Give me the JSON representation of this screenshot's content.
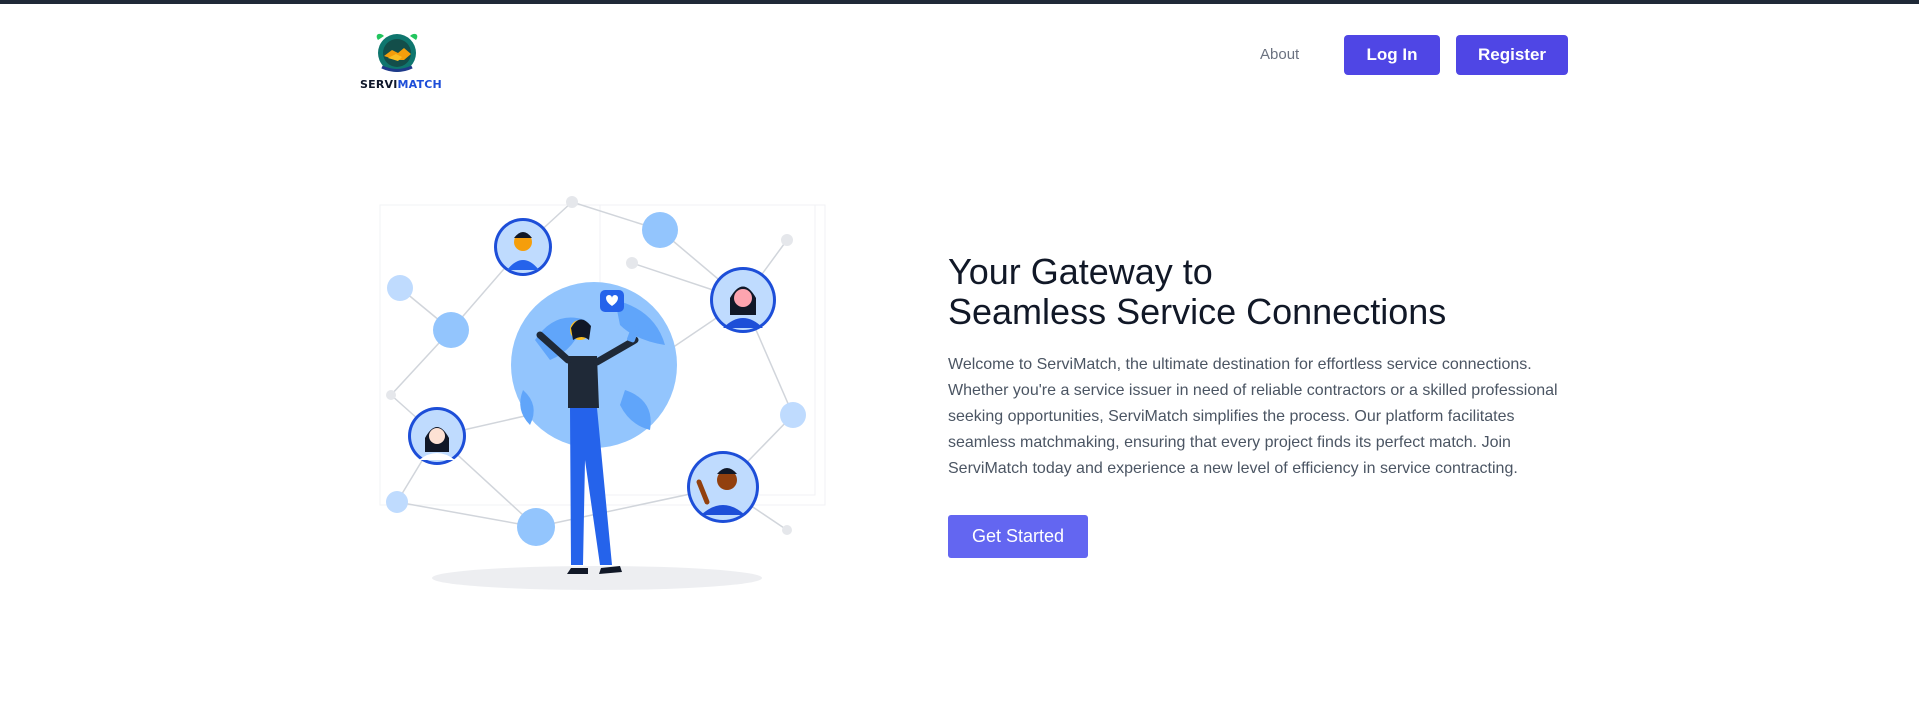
{
  "brand": {
    "logo_text_part1": "SERVI",
    "logo_text_part2": "MATCH",
    "primary_color": "#4f46e5",
    "cta_color": "#6366f1"
  },
  "nav": {
    "about": "About",
    "login": "Log In",
    "register": "Register"
  },
  "hero": {
    "title_line1": "Your Gateway to",
    "title_line2": "Seamless Service Connections",
    "description": "Welcome to ServiMatch, the ultimate destination for effortless service connections. Whether you're a service issuer in need of reliable contractors or a skilled professional seeking opportunities, ServiMatch simplifies the process. Our platform facilitates seamless matchmaking, ensuring that every project finds its perfect match. Join ServiMatch today and experience a new level of efficiency in service contracting.",
    "cta": "Get Started"
  },
  "illustration": {
    "icon": "global-network-illustration",
    "colors": {
      "light_blue": "#93c5fd",
      "mid_blue": "#60a5fa",
      "dark_blue": "#1d4ed8"
    }
  }
}
